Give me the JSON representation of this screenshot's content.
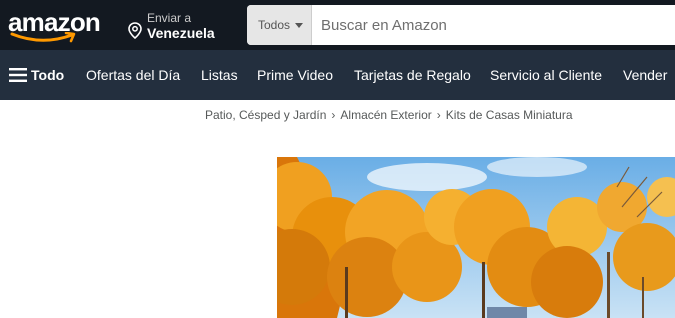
{
  "header": {
    "logo_text": "amazon",
    "deliver_line1": "Enviar a",
    "deliver_line2": "Venezuela",
    "search_category": "Todos",
    "search_placeholder": "Buscar en Amazon"
  },
  "nav": {
    "all_label": "Todo",
    "items": [
      "Ofertas del Día",
      "Listas",
      "Prime Video",
      "Tarjetas de Regalo",
      "Servicio al Cliente",
      "Vender"
    ]
  },
  "breadcrumb": [
    "Patio, Césped y Jardín",
    "Almacén Exterior",
    "Kits de Casas Miniatura"
  ],
  "colors": {
    "topbar": "#131921",
    "navbar": "#232f3e",
    "smile": "#ff9900",
    "foliage": "#e8900c",
    "sky": "#7ab8e8"
  }
}
